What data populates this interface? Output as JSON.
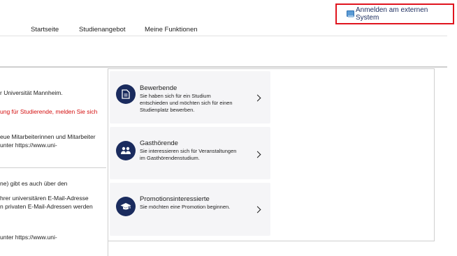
{
  "header": {
    "external_login_label": "Anmelden am externen System"
  },
  "nav": {
    "items": [
      {
        "label": "Startseite"
      },
      {
        "label": "Studienangebot"
      },
      {
        "label": "Meine Funktionen"
      }
    ]
  },
  "left": {
    "lines": [
      "r Universität Mannheim.",
      "ung für Studierende, melden Sie sich",
      "eue Mitarbeiterinnen und Mitarbeiter",
      "unter  https://www.uni-",
      "ne) gibt es auch über den",
      "hrer universitären E-Mail-Adresse",
      "n privaten E-Mail-Adressen werden",
      "unter  https://www.uni-"
    ]
  },
  "cards": [
    {
      "title": "Bewerbende",
      "desc": [
        "Sie haben sich für ein Studium",
        "entschieden und möchten sich für einen",
        "Studienplatz bewerben."
      ],
      "icon": "document-icon"
    },
    {
      "title": "Gasthörende",
      "desc": [
        "Sie interessieren sich für Veranstaltungen",
        "im Gasthörendenstudium."
      ],
      "icon": "people-icon"
    },
    {
      "title": "Promotionsinteressierte",
      "desc": [
        "Sie möchten eine Promotion beginnen."
      ],
      "icon": "graduation-cap-icon"
    }
  ]
}
